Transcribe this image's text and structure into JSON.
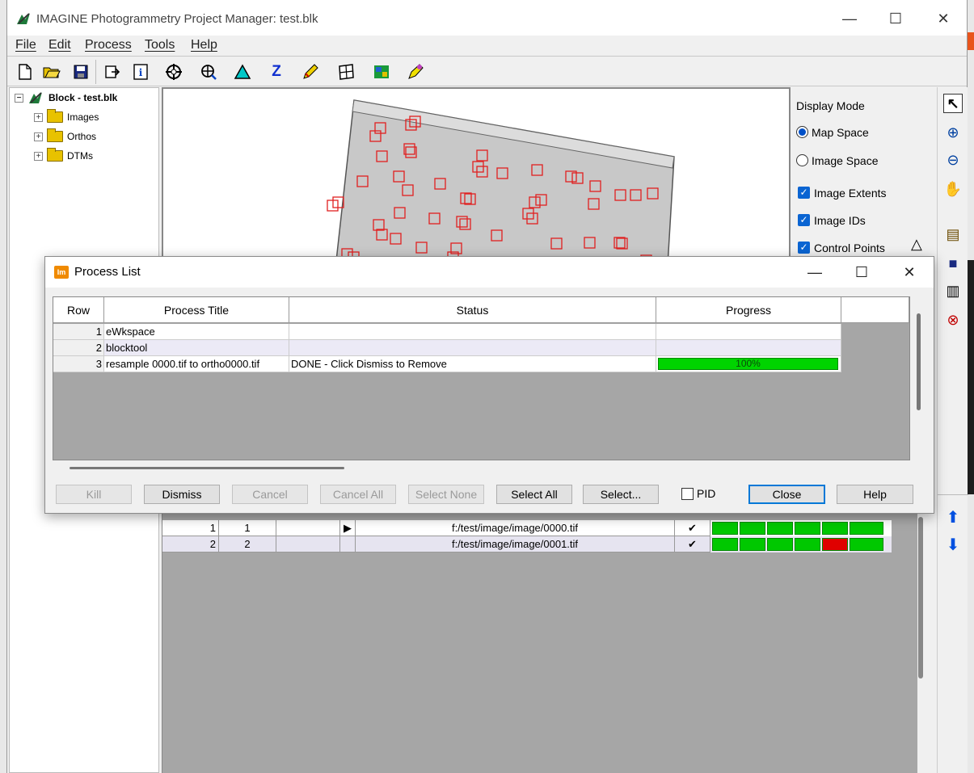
{
  "window": {
    "title": "IMAGINE Photogrammetry Project Manager: test.blk",
    "min_glyph": "—",
    "max_glyph": "☐",
    "close_glyph": "✕"
  },
  "menu": {
    "file": "File",
    "edit": "Edit",
    "process": "Process",
    "tools": "Tools",
    "help": "Help"
  },
  "toolbar": {
    "icons": [
      "new-document-icon",
      "open-folder-icon",
      "save-icon",
      "export-icon",
      "info-icon",
      "crosshair-icon",
      "add-point-icon",
      "triangle-icon",
      "z-icon",
      "edit-icon",
      "grid-icon",
      "ortho-icon",
      "measure-icon"
    ],
    "z_glyph": "Z",
    "info_glyph": "i"
  },
  "tree": {
    "root": "Block - test.blk",
    "children": [
      "Images",
      "Orthos",
      "DTMs"
    ],
    "plus": "+",
    "minus": "−"
  },
  "display_mode": {
    "heading": "Display Mode",
    "map_space": "Map Space",
    "image_space": "Image Space",
    "image_extents": "Image Extents",
    "image_ids": "Image IDs",
    "control_points": "Control Points",
    "check_glyph": "✓",
    "triangle_glyph": "△"
  },
  "lower_grid": {
    "rows": [
      {
        "num": "1",
        "id": "1",
        "marker": "▶",
        "path": "f:/test/image/image/0000.tif",
        "check": "✔",
        "status": [
          "ok",
          "ok",
          "ok",
          "ok",
          "ok",
          "ok"
        ]
      },
      {
        "num": "2",
        "id": "2",
        "marker": "",
        "path": "f:/test/image/image/0001.tif",
        "check": "✔",
        "status": [
          "ok",
          "ok",
          "ok",
          "ok",
          "fail",
          "ok"
        ]
      }
    ],
    "ok_color": "#00c800",
    "fail_color": "#e00000"
  },
  "dialog": {
    "title": "Process List",
    "icon_text": "Im",
    "headers": {
      "row": "Row",
      "title": "Process Title",
      "status": "Status",
      "progress": "Progress"
    },
    "rows": [
      {
        "row": "1",
        "title": "eWkspace",
        "status": "",
        "progress": null
      },
      {
        "row": "2",
        "title": "blocktool",
        "status": "",
        "progress": null
      },
      {
        "row": "3",
        "title": "resample 0000.tif to ortho0000.tif",
        "status": "DONE - Click Dismiss to Remove",
        "progress": 1.0,
        "progress_label": "100%"
      }
    ],
    "buttons": {
      "kill": "Kill",
      "dismiss": "Dismiss",
      "cancel": "Cancel",
      "cancel_all": "Cancel All",
      "select_none": "Select None",
      "select_all": "Select All",
      "select": "Select...",
      "pid": "PID",
      "close": "Close",
      "help": "Help"
    },
    "progress_color": "#00d400"
  },
  "right_tools": {
    "icons": [
      "select-arrow-icon",
      "zoom-in-icon",
      "zoom-out-icon",
      "pan-hand-icon",
      "properties-icon",
      "save-icon",
      "print-icon",
      "zoom-clear-icon",
      "up-arrow-icon",
      "down-arrow-icon"
    ],
    "glyphs": [
      "↖",
      "⊕",
      "⊖",
      "✋",
      "▤",
      "■",
      "▥",
      "⊗",
      "⬆",
      "⬇"
    ]
  }
}
